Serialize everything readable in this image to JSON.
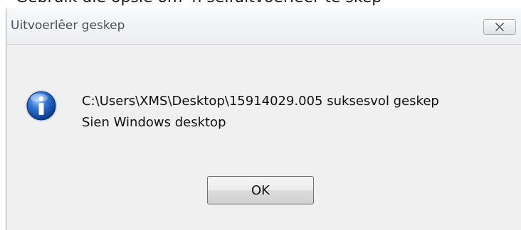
{
  "background_text": "Gebruik dié opsie om 'n selfuitvoerlêer te skep",
  "dialog": {
    "title": "Uitvoerlêer geskep",
    "icon": "info-icon",
    "close_icon": "close-icon",
    "message_line1": "C:\\Users\\XMS\\Desktop\\15914029.005 suksesvol geskep",
    "message_line2": "Sien Windows desktop",
    "ok_label": "OK"
  },
  "colors": {
    "dialog_bg": "#f0f0f0",
    "title_text": "#4a4f57",
    "icon_blue": "#1f5fbf"
  }
}
